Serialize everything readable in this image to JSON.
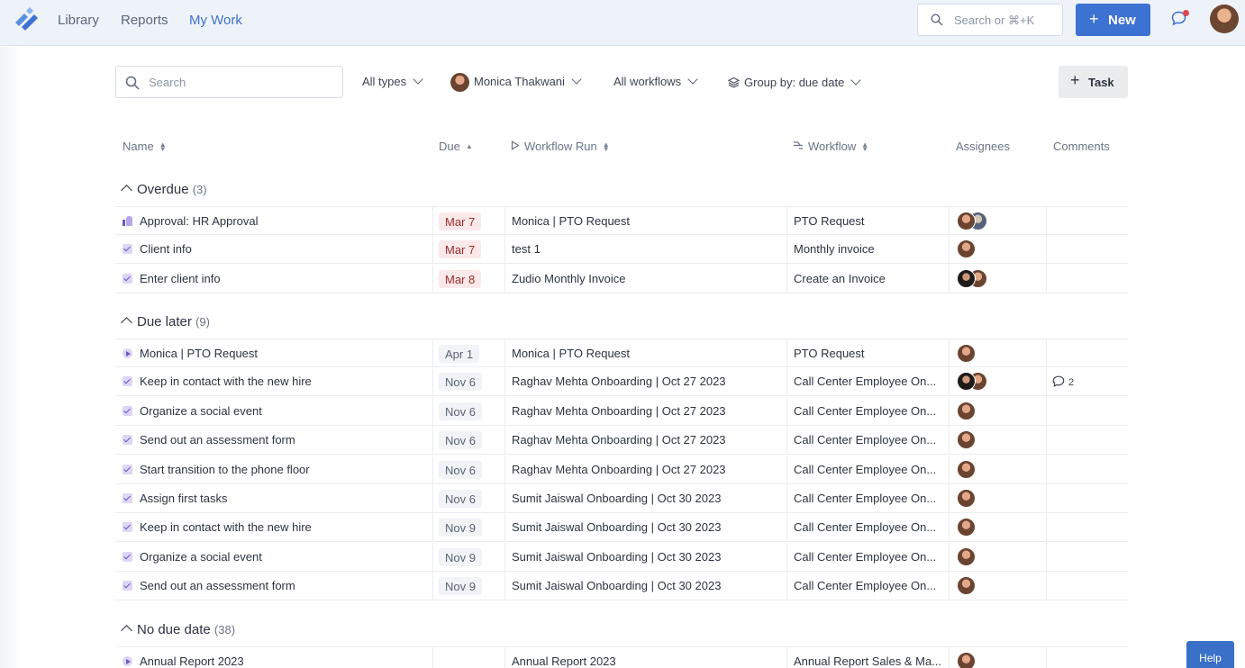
{
  "nav": {
    "links": [
      "Library",
      "Reports",
      "My Work"
    ],
    "search_placeholder": "Search or ⌘+K",
    "new_label": "New"
  },
  "filters": {
    "search_placeholder": "Search",
    "types": "All types",
    "user": "Monica Thakwani",
    "workflows": "All workflows",
    "group_by": "Group by: due date",
    "task_button": "Task"
  },
  "columns": [
    "Name",
    "Due",
    "Workflow Run",
    "Workflow",
    "Assignees",
    "Comments"
  ],
  "groups": [
    {
      "title": "Overdue",
      "count": "(3)",
      "rows": [
        {
          "icon": "thumb",
          "name": "Approval: HR Approval",
          "due": "Mar 7",
          "run": "Monica | PTO Request",
          "workflow": "PTO Request",
          "assignees": [
            "a",
            "b"
          ],
          "comments": ""
        },
        {
          "icon": "check",
          "name": "Client info",
          "due": "Mar 7",
          "run": "test 1",
          "workflow": "Monthly invoice",
          "assignees": [
            "a"
          ],
          "comments": ""
        },
        {
          "icon": "check",
          "name": "Enter client info",
          "due": "Mar 8",
          "run": "Zudio Monthly Invoice",
          "workflow": "Create an Invoice",
          "assignees": [
            "c",
            "a"
          ],
          "comments": ""
        }
      ]
    },
    {
      "title": "Due later",
      "count": "(9)",
      "rows": [
        {
          "icon": "play",
          "name": "Monica | PTO Request",
          "due": "Apr 1",
          "run": "Monica | PTO Request",
          "workflow": "PTO Request",
          "assignees": [
            "a"
          ],
          "comments": ""
        },
        {
          "icon": "check",
          "name": "Keep in contact with the new hire",
          "due": "Nov 6",
          "run": "Raghav Mehta Onboarding | Oct 27 2023",
          "workflow": "Call Center Employee On...",
          "assignees": [
            "c",
            "a"
          ],
          "comments": "2"
        },
        {
          "icon": "check",
          "name": "Organize a social event",
          "due": "Nov 6",
          "run": "Raghav Mehta Onboarding | Oct 27 2023",
          "workflow": "Call Center Employee On...",
          "assignees": [
            "a"
          ],
          "comments": ""
        },
        {
          "icon": "check",
          "name": "Send out an assessment form",
          "due": "Nov 6",
          "run": "Raghav Mehta Onboarding | Oct 27 2023",
          "workflow": "Call Center Employee On...",
          "assignees": [
            "a"
          ],
          "comments": ""
        },
        {
          "icon": "check",
          "name": "Start transition to the phone floor",
          "due": "Nov 6",
          "run": "Raghav Mehta Onboarding | Oct 27 2023",
          "workflow": "Call Center Employee On...",
          "assignees": [
            "a"
          ],
          "comments": ""
        },
        {
          "icon": "check",
          "name": "Assign first tasks",
          "due": "Nov 6",
          "run": "Sumit Jaiswal Onboarding | Oct 30 2023",
          "workflow": "Call Center Employee On...",
          "assignees": [
            "a"
          ],
          "comments": ""
        },
        {
          "icon": "check",
          "name": "Keep in contact with the new hire",
          "due": "Nov 9",
          "run": "Sumit Jaiswal Onboarding | Oct 30 2023",
          "workflow": "Call Center Employee On...",
          "assignees": [
            "a"
          ],
          "comments": ""
        },
        {
          "icon": "check",
          "name": "Organize a social event",
          "due": "Nov 9",
          "run": "Sumit Jaiswal Onboarding | Oct 30 2023",
          "workflow": "Call Center Employee On...",
          "assignees": [
            "a"
          ],
          "comments": ""
        },
        {
          "icon": "check",
          "name": "Send out an assessment form",
          "due": "Nov 9",
          "run": "Sumit Jaiswal Onboarding | Oct 30 2023",
          "workflow": "Call Center Employee On...",
          "assignees": [
            "a"
          ],
          "comments": ""
        }
      ]
    },
    {
      "title": "No due date",
      "count": "(38)",
      "rows": [
        {
          "icon": "play",
          "name": "Annual Report 2023",
          "due": "",
          "run": "Annual Report 2023",
          "workflow": "Annual Report Sales & Ma...",
          "assignees": [
            "a"
          ],
          "comments": ""
        }
      ]
    }
  ],
  "help_label": "Help",
  "colors": {
    "primary": "#3c72d1",
    "overdue_bg": "#fbe9e9",
    "overdue_text": "#9b2a2a",
    "nav_bg": "#eef3fa"
  }
}
